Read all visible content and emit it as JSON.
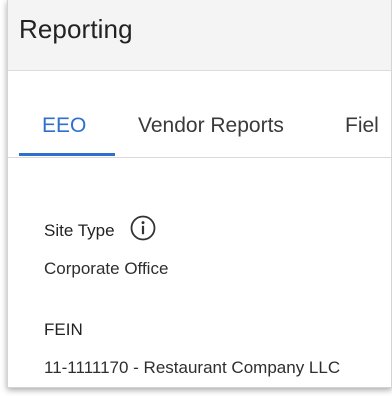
{
  "header": {
    "title": "Reporting"
  },
  "tabs": [
    {
      "label": "EEO",
      "active": true
    },
    {
      "label": "Vendor Reports",
      "active": false
    },
    {
      "label": "Fiel",
      "active": false
    }
  ],
  "fields": {
    "site_type": {
      "label": "Site Type",
      "value": "Corporate Office",
      "icon": "info-icon"
    },
    "fein": {
      "label": "FEIN",
      "value": "11-1111170 - Restaurant Company LLC"
    }
  },
  "colors": {
    "accent": "#2f6fcf",
    "header_bg": "#f4f4f4",
    "text": "#222222"
  }
}
